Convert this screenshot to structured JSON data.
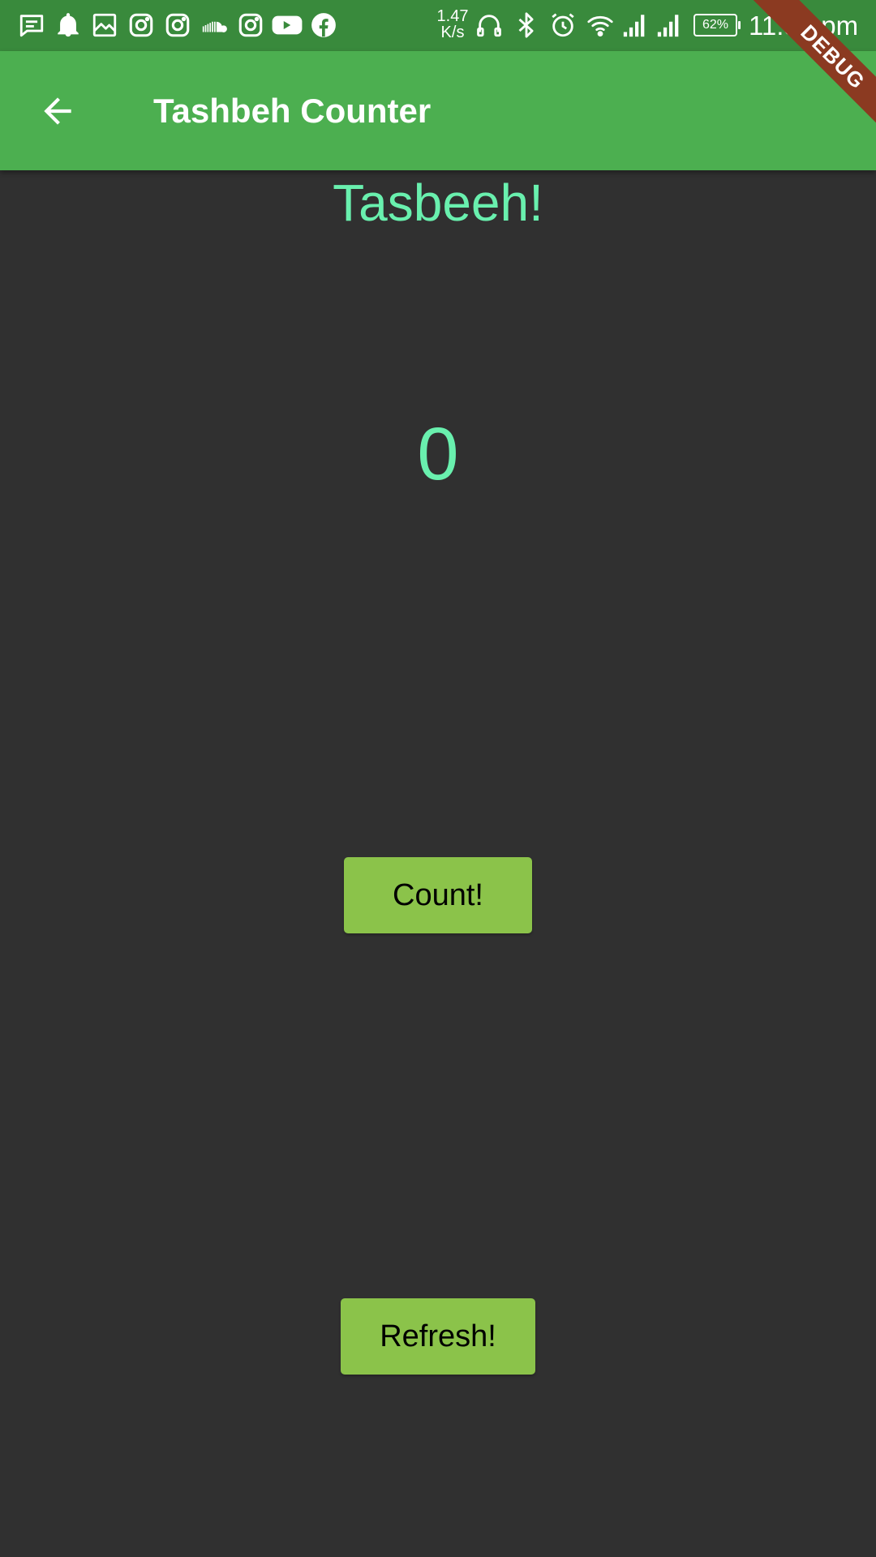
{
  "status_bar": {
    "icons": [
      "message-icon",
      "notification-bell-icon",
      "image-icon",
      "instagram-icon",
      "instagram-icon",
      "soundcloud-icon",
      "instagram-icon",
      "youtube-icon",
      "facebook-icon",
      "headset-icon",
      "bluetooth-icon",
      "alarm-icon",
      "wifi-icon",
      "signal-icon",
      "signal-icon"
    ],
    "net_speed_value": "1.47",
    "net_speed_unit": "K/s",
    "battery": "62%",
    "time": "11:52 pm"
  },
  "app_bar": {
    "title": "Tashbeh Counter",
    "back_icon": "arrow-back-icon",
    "color": "#4caf50"
  },
  "debug_banner": "DEBUG",
  "main": {
    "heading": "Tasbeeh!",
    "count": "0",
    "count_button": "Count!",
    "refresh_button": "Refresh!",
    "accent_color": "#69f0ae",
    "button_color": "#8bc34a",
    "background": "#303030"
  }
}
